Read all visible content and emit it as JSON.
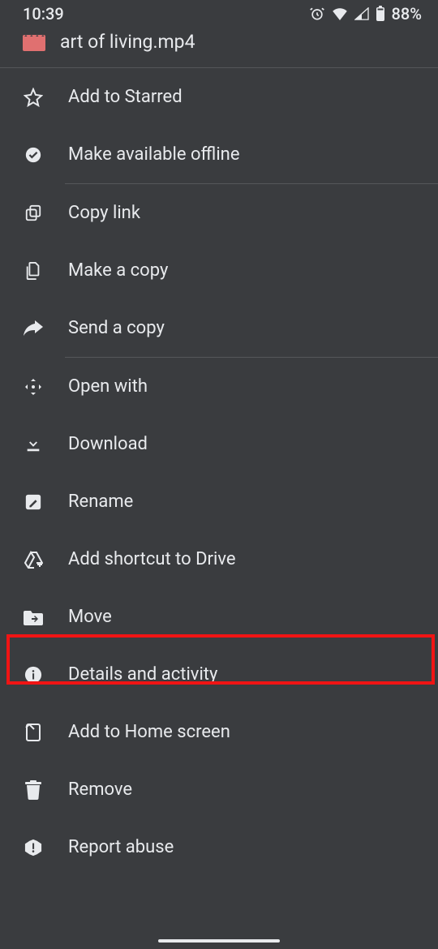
{
  "status": {
    "time": "10:39",
    "battery": "88%"
  },
  "file": {
    "name": "art of living.mp4"
  },
  "menu": {
    "add_starred": "Add to Starred",
    "offline": "Make available offline",
    "copy_link": "Copy link",
    "make_copy": "Make a copy",
    "send_copy": "Send a copy",
    "open_with": "Open with",
    "download": "Download",
    "rename": "Rename",
    "add_shortcut": "Add shortcut to Drive",
    "move": "Move",
    "details": "Details and activity",
    "add_home": "Add to Home screen",
    "remove": "Remove",
    "report": "Report abuse"
  }
}
